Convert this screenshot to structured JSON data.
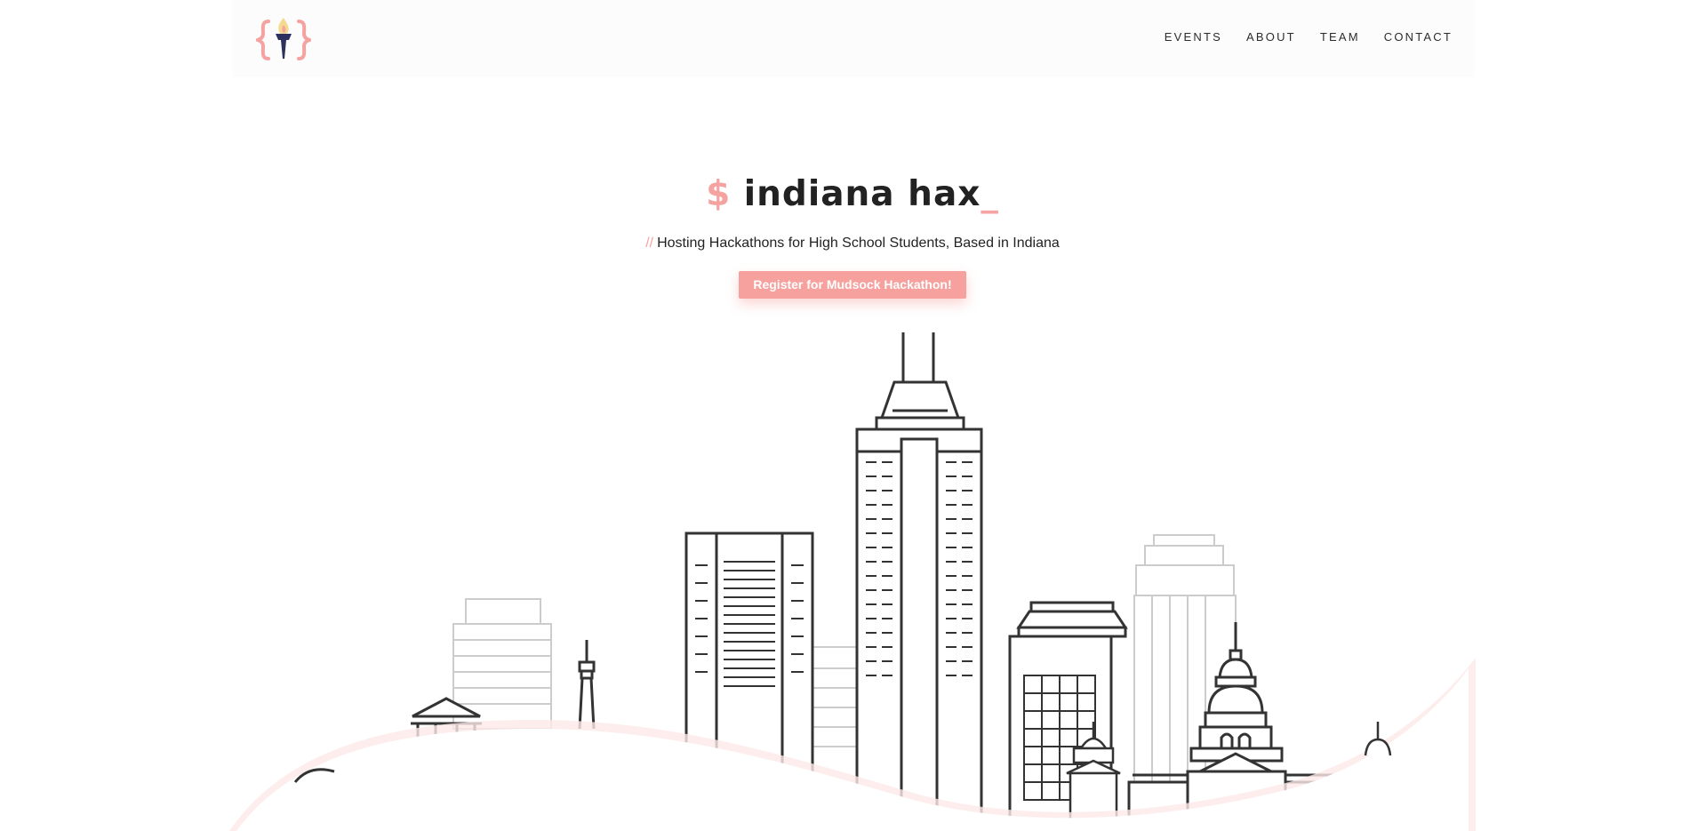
{
  "nav": {
    "logo_alt": "Indiana Hax torch logo",
    "items": [
      {
        "label": "EVENTS"
      },
      {
        "label": "ABOUT"
      },
      {
        "label": "TEAM"
      },
      {
        "label": "CONTACT"
      }
    ]
  },
  "hero": {
    "prompt_symbol": "$",
    "title": "indiana hax",
    "cursor": "_",
    "subtitle_prefix": "//",
    "subtitle": "Hosting Hackathons for High School Students, Based in Indiana",
    "cta_label": "Register for Mudsock Hackathon!"
  },
  "colors": {
    "accent": "#f5a3a0",
    "text": "#222222",
    "navbar_bg": "#fcfcfc",
    "torch_blue": "#2d3160",
    "flame": "#f5d98c",
    "building_dark": "#333333",
    "building_light": "#cccccc"
  },
  "icons": {
    "logo": "torch-braces-icon"
  }
}
